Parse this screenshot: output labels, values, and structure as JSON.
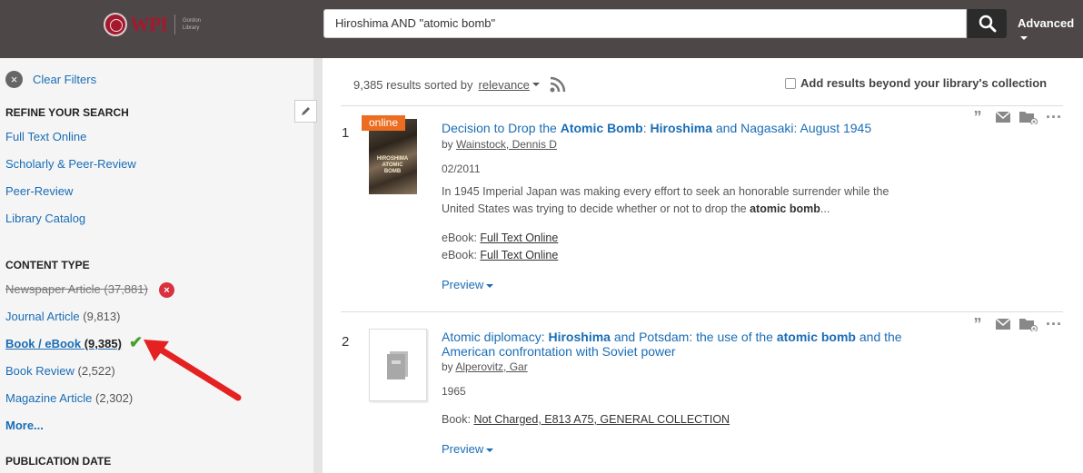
{
  "header": {
    "logo_wordmark": "WPI",
    "logo_sub": [
      "Gordon",
      "Library"
    ],
    "search_value": "Hiroshima AND \"atomic bomb\"",
    "advanced_label": "Advanced"
  },
  "sidebar": {
    "clear_filters": "Clear Filters",
    "refine_heading": "REFINE YOUR SEARCH",
    "refine_items": [
      "Full Text Online",
      "Scholarly & Peer-Review",
      "Peer-Review",
      "Library Catalog"
    ],
    "content_type_heading": "CONTENT TYPE",
    "content_types": [
      {
        "label": "Newspaper Article",
        "count": "(37,881)",
        "state": "excluded"
      },
      {
        "label": "Journal Article",
        "count": "(9,813)",
        "state": "normal"
      },
      {
        "label": "Book / eBook",
        "count": "(9,385)",
        "state": "selected"
      },
      {
        "label": "Book Review",
        "count": "(2,522)",
        "state": "normal"
      },
      {
        "label": "Magazine Article",
        "count": "(2,302)",
        "state": "normal"
      }
    ],
    "more_label": "More...",
    "publication_date_heading": "PUBLICATION DATE"
  },
  "results": {
    "summary": "9,385 results sorted by",
    "sort_value": "relevance",
    "beyond_label": "Add results beyond your library's collection",
    "items": [
      {
        "num": "1",
        "badge": "online",
        "title_parts": [
          {
            "t": "Decision to Drop the ",
            "b": false
          },
          {
            "t": "Atomic Bomb",
            "b": true
          },
          {
            "t": ": ",
            "b": false
          },
          {
            "t": "Hiroshima",
            "b": true
          },
          {
            "t": " and Nagasaki: August 1945",
            "b": false
          }
        ],
        "author_prefix": "by ",
        "author": "Wainstock, Dennis D",
        "date": "02/2011",
        "abstract_parts": [
          {
            "t": "In 1945 Imperial Japan was making every effort to seek an honorable surrender while the United States was trying to decide whether or not to drop the ",
            "b": false
          },
          {
            "t": "atomic bomb",
            "b": true
          },
          {
            "t": "...",
            "b": false
          }
        ],
        "holdings": [
          {
            "label": "eBook:",
            "link": "Full Text Online"
          },
          {
            "label": "eBook:",
            "link": "Full Text Online"
          }
        ],
        "preview": "Preview"
      },
      {
        "num": "2",
        "title_parts": [
          {
            "t": "Atomic diplomacy: ",
            "b": false
          },
          {
            "t": "Hiroshima",
            "b": true
          },
          {
            "t": " and Potsdam: the use of the ",
            "b": false
          },
          {
            "t": "atomic bomb",
            "b": true
          },
          {
            "t": " and the American confrontation with Soviet power",
            "b": false
          }
        ],
        "author_prefix": "by ",
        "author": "Alperovitz, Gar",
        "date": "1965",
        "holdings": [
          {
            "label": "Book:",
            "link": "Not Charged, E813 A75, GENERAL COLLECTION"
          }
        ],
        "preview": "Preview"
      }
    ]
  },
  "action_icons": [
    "quote-icon",
    "email-icon",
    "folder-add-icon",
    "more-icon"
  ],
  "colors": {
    "header_bg": "#4e4747",
    "link": "#1a6db5",
    "online_badge": "#ec6d1f",
    "remove": "#d9313e",
    "check": "#4aa02c",
    "arrow": "#e52222"
  }
}
